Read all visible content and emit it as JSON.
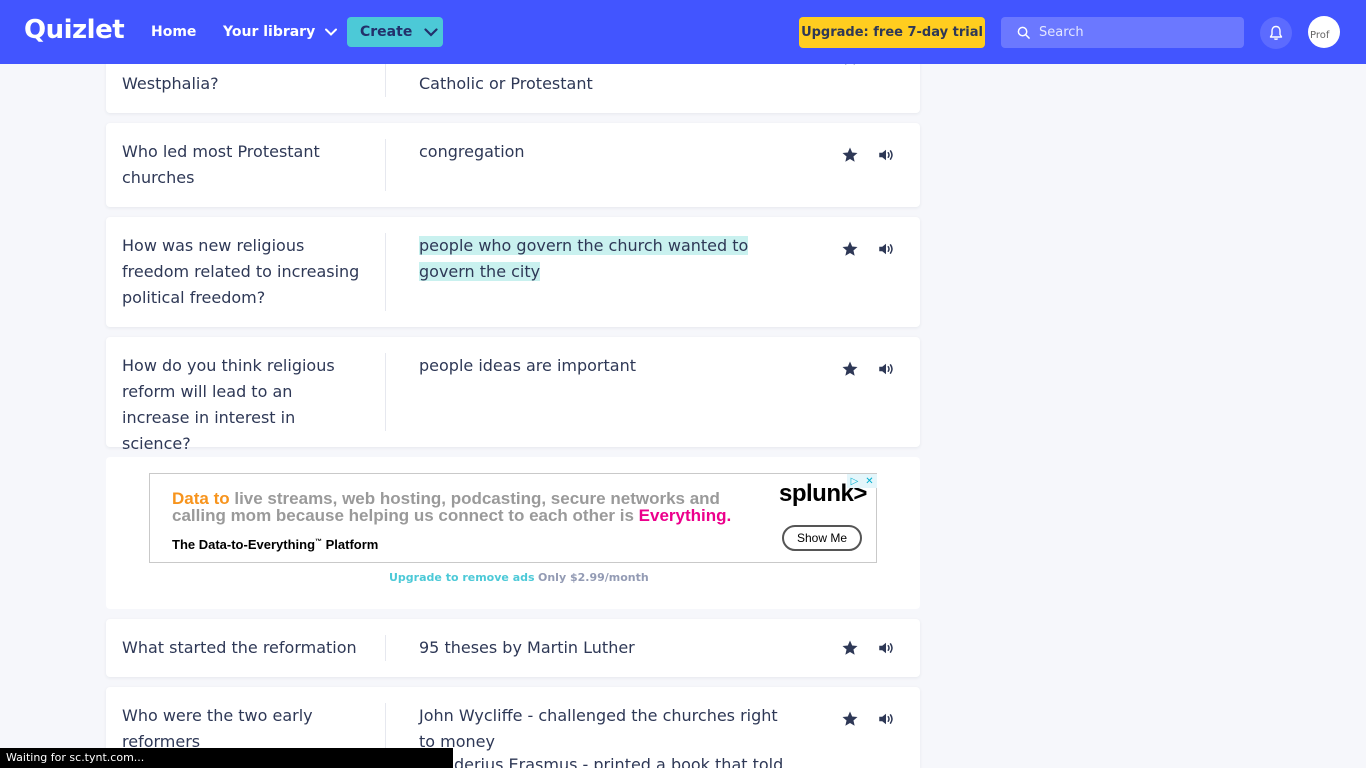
{
  "header": {
    "logo": "Quizlet",
    "nav": {
      "home": "Home",
      "library": "Your library"
    },
    "create_label": "Create",
    "upgrade_label": "Upgrade: free 7-day trial",
    "search_placeholder": "Search",
    "avatar_alt": "Prof"
  },
  "cards": [
    {
      "term": "Westphalia?",
      "definition": "Catholic or Protestant"
    },
    {
      "term": "Who led most Protestant churches",
      "definition": "congregation"
    },
    {
      "term": "How was new religious freedom related to increasing political freedom?",
      "definition": "people who govern the church wanted to govern the city"
    },
    {
      "term": "How do you think religious reform will lead to an increase in interest in science?",
      "definition": "people ideas are important"
    },
    {
      "term": "What started the reformation",
      "definition": "95 theses by Martin Luther"
    },
    {
      "term": "Who were the two early reformers",
      "definition": "John Wycliffe - challenged the churches right to money",
      "definition_more": "Desiderius Erasmus - printed a book that told of the"
    }
  ],
  "ad": {
    "line_orange": "Data to",
    "line_gray": " live streams, web hosting, podcasting, secure networks and calling mom because helping us connect to each other is ",
    "line_pink": "Everything.",
    "tagline": "The Data-to-Everything",
    "tagline_tm": "™",
    "tagline_end": " Platform",
    "logo": "splunk>",
    "cta": "Show Me",
    "choices_info": "▷",
    "choices_close": "✕",
    "upgrade_link": "Upgrade to remove ads",
    "price": "Only $2.99/month"
  },
  "status_bar": "Waiting for sc.tynt.com...",
  "colors": {
    "header_bg": "#4255ff",
    "create_bg": "#4cc9d7",
    "upgrade_bg": "#ffcd1f",
    "highlight": "#c9f1ef",
    "page_bg": "#f6f7fb"
  }
}
